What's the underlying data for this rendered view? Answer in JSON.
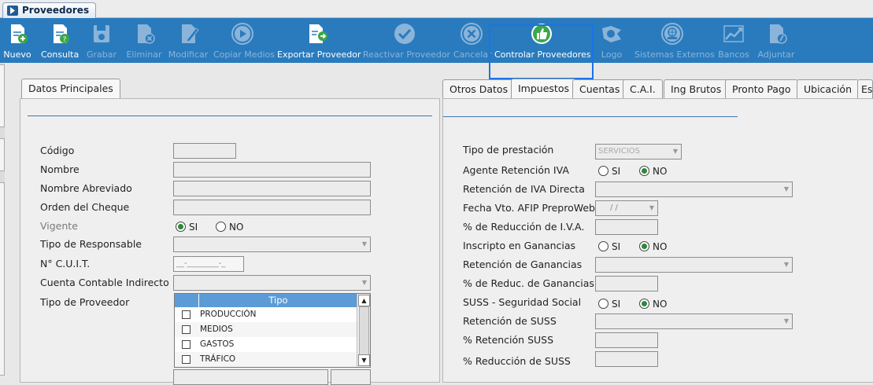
{
  "window": {
    "tab_title": "Proveedores"
  },
  "toolbar": {
    "buttons": [
      {
        "label": "Nuevo",
        "icon": "new-doc-icon",
        "enabled": true
      },
      {
        "label": "Consulta",
        "icon": "query-doc-icon",
        "enabled": true
      },
      {
        "label": "Grabar",
        "icon": "save-icon",
        "enabled": false
      },
      {
        "label": "Eliminar",
        "icon": "delete-doc-icon",
        "enabled": false
      },
      {
        "label": "Modificar",
        "icon": "edit-doc-icon",
        "enabled": false
      },
      {
        "label": "Copiar Medios",
        "icon": "play-circle-icon",
        "enabled": false
      },
      {
        "label": "Exportar Proveedor",
        "icon": "export-doc-icon",
        "enabled": true
      },
      {
        "label": "Reactivar Proveedor",
        "icon": "check-circle-icon",
        "enabled": false
      },
      {
        "label": "Cancelar",
        "icon": "cancel-circle-icon",
        "enabled": false
      },
      {
        "label": "Controlar Proveedores",
        "icon": "thumbs-up-icon",
        "enabled": true
      },
      {
        "label": "Logo",
        "icon": "logo-icon",
        "enabled": false
      },
      {
        "label": "Sistemas Externos",
        "icon": "external-systems-icon",
        "enabled": false
      },
      {
        "label": "Bancos",
        "icon": "chart-icon",
        "enabled": false
      },
      {
        "label": "Adjuntar",
        "icon": "attach-icon",
        "enabled": false
      }
    ]
  },
  "left_panel": {
    "tab": "Datos Principales",
    "fields": {
      "codigo": "Código",
      "nombre": "Nombre",
      "nombre_abreviado": "Nombre Abreviado",
      "orden_cheque": "Orden del Cheque",
      "vigente": "Vigente",
      "tipo_responsable": "Tipo de Responsable",
      "cuit": "N° C.U.I.T.",
      "cuit_mask": "__-________-_",
      "cuenta_contable": "Cuenta Contable Indirecto",
      "tipo_proveedor": "Tipo de Proveedor"
    },
    "vigente_options": {
      "si": "SI",
      "no": "NO",
      "selected": "si"
    },
    "tipo_grid": {
      "header": "Tipo",
      "rows": [
        "PRODUCCIÓN",
        "MEDIOS",
        "GASTOS",
        "TRÁFICO"
      ]
    }
  },
  "right_panel": {
    "tabs": [
      "Otros Datos",
      "Impuestos",
      "Cuentas",
      "C.A.I.",
      "Ing Brutos",
      "Pronto Pago",
      "Ubicación",
      "Es"
    ],
    "active_tab": "Impuestos",
    "fields": {
      "tipo_prestacion": "Tipo de prestación",
      "tipo_prestacion_value": "SERVICIOS",
      "agente_retencion_iva": "Agente Retención IVA",
      "retencion_iva_directa": "Retención de IVA Directa",
      "fecha_vto_afip": "Fecha Vto. AFIP PreproWeb",
      "fecha_mask": "/ /",
      "reduccion_iva": "% de Reducción de I.V.A.",
      "inscripto_ganancias": "Inscripto en Ganancias",
      "retencion_ganancias": "Retención de Ganancias",
      "reduc_ganancias": "% de Reduc. de Ganancias",
      "suss": "SUSS - Seguridad Social",
      "retencion_suss": "Retención de SUSS",
      "pct_retencion_suss": "% Retención SUSS",
      "pct_reduccion_suss": "% Reducción de SUSS"
    },
    "radios": {
      "si": "SI",
      "no": "NO"
    }
  }
}
